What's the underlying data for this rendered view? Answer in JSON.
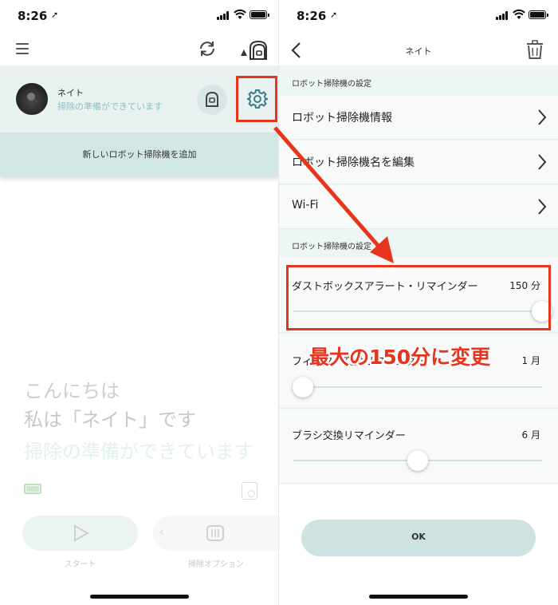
{
  "status_bar": {
    "time": "8:26",
    "location_arrow": "➚"
  },
  "left_screen": {
    "robot": {
      "name": "ネイト",
      "status": "掃除の準備ができています"
    },
    "add_robot_label": "新しいロボット掃除機を追加",
    "greeting": {
      "line1": "こんにちは",
      "line2": "私は「ネイト」です",
      "line3": "掃除の準備ができています"
    },
    "controls": {
      "start_label": "スタート",
      "options_label": "掃除オプション",
      "options_chevron": "‹"
    }
  },
  "right_screen": {
    "title": "ネイト",
    "section1_title": "ロボット掃除機の設定",
    "menu_items": [
      {
        "label": "ロボット掃除機情報"
      },
      {
        "label": "ロボット掃除機名を編集"
      },
      {
        "label": "Wi-Fi"
      }
    ],
    "section2_title": "ロボット掃除機の設定",
    "sliders": [
      {
        "label": "ダストボックスアラート・リマインダー",
        "value": "150 分",
        "level": 1.0
      },
      {
        "label": "フィルター交換リマインダー",
        "value": "1 月",
        "level": 0.04
      },
      {
        "label": "ブラシ交換リマインダー",
        "value": "6 月",
        "level": 0.5
      }
    ],
    "ok_label": "OK"
  },
  "annotation": {
    "text": "最大の150分に変更",
    "color": "#e8341c"
  },
  "colors": {
    "accent": "#8ac3c6",
    "highlight": "#e8341c",
    "teal_light": "#d3e6e6"
  },
  "icons": [
    "hamburger-icon",
    "sync-icon",
    "robot-switch-icon",
    "dock-icon",
    "gear-icon",
    "back-icon",
    "trash-icon",
    "chevron-right-icon",
    "battery-icon",
    "map-icon",
    "play-icon",
    "cleaning-options-icon"
  ]
}
